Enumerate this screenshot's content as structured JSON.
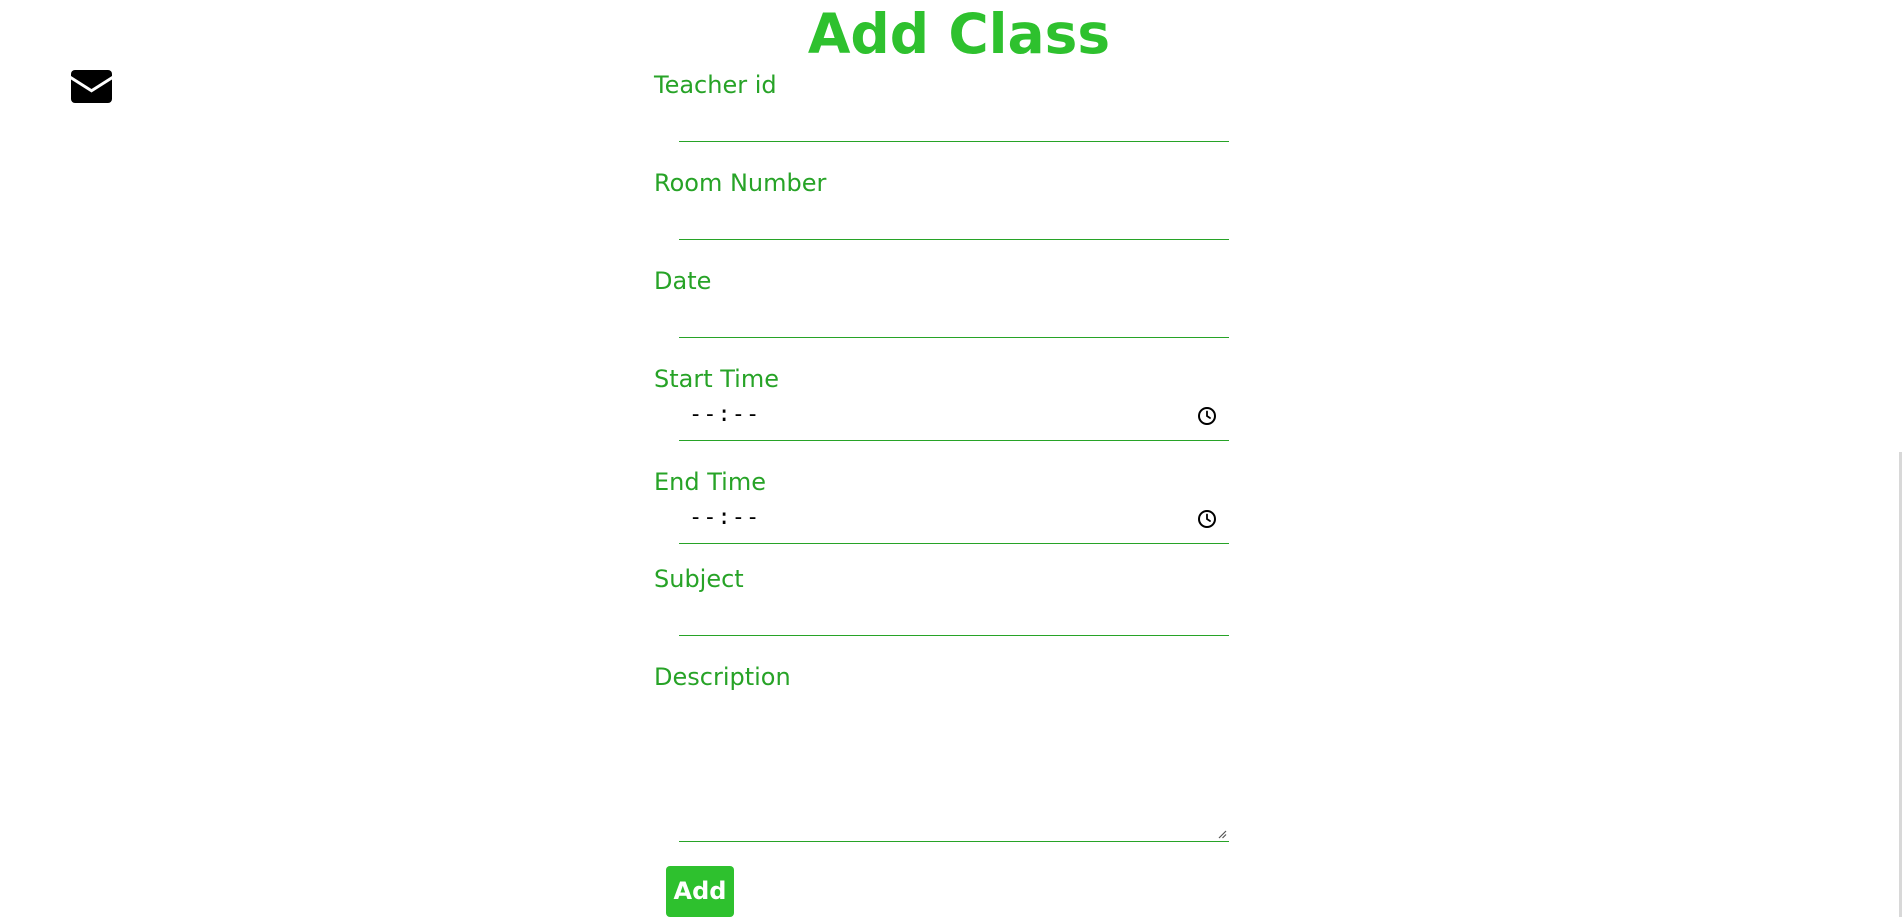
{
  "page": {
    "title": "Add Class",
    "accent_color": "#2ec12e",
    "label_color": "#27a327"
  },
  "header": {
    "icon": "envelope-icon"
  },
  "form": {
    "teacher_id_label": "Teacher id",
    "teacher_id_value": "",
    "room_number_label": "Room Number",
    "room_number_value": "",
    "date_label": "Date",
    "date_value": "",
    "start_time_label": "Start Time",
    "start_time_value": "--:--",
    "end_time_label": "End Time",
    "end_time_value": "--:--",
    "subject_label": "Subject",
    "subject_value": "",
    "description_label": "Description",
    "description_value": "",
    "time_icon": "clock-icon",
    "submit_label": "Add"
  }
}
